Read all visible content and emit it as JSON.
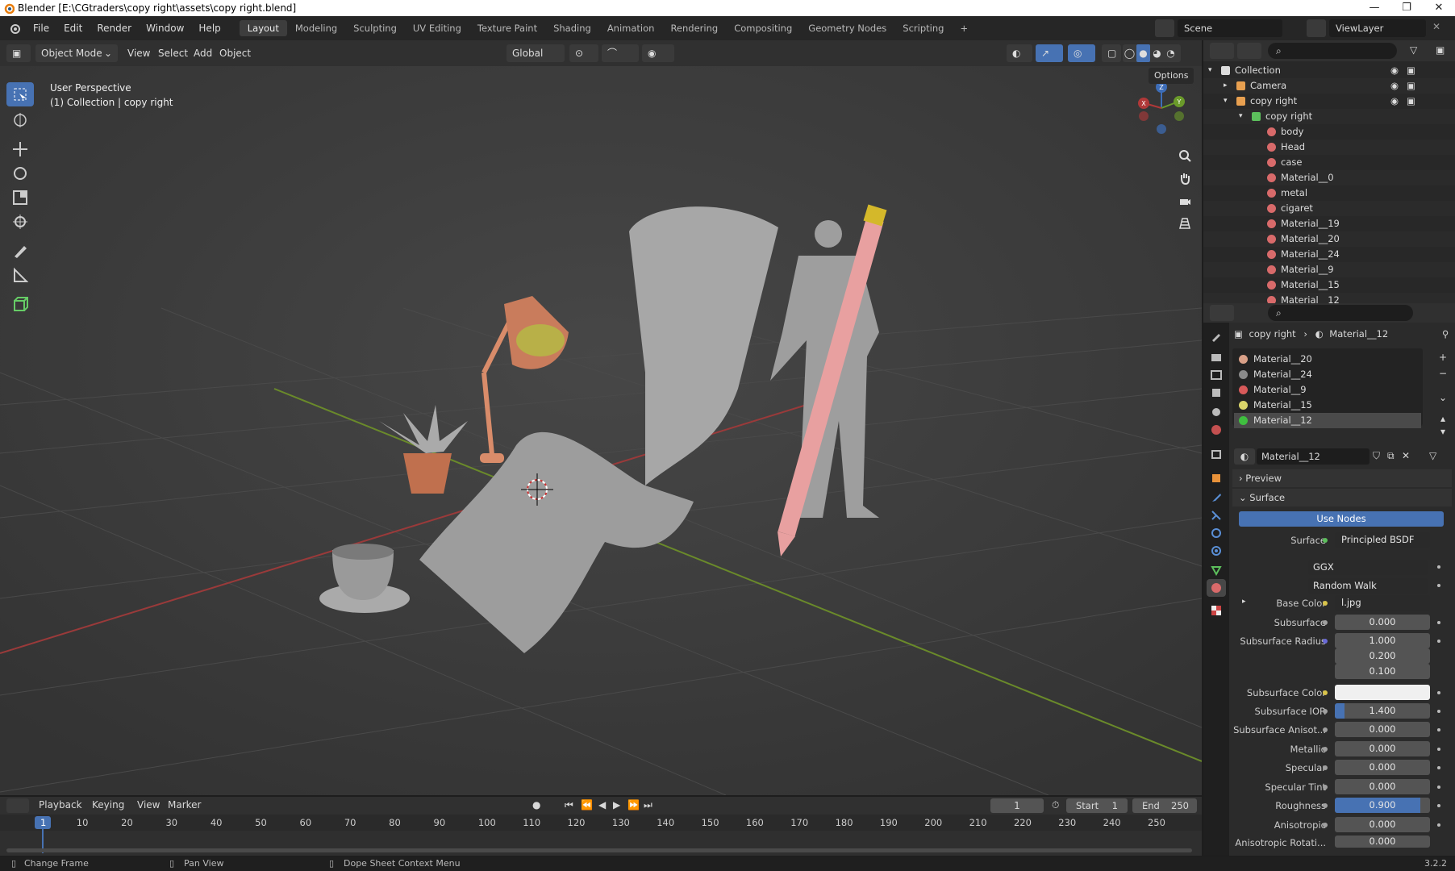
{
  "window": {
    "title": "Blender [E:\\CGtraders\\copy right\\assets\\copy right.blend]",
    "minimize": "—",
    "maximize": "❐",
    "close": "✕"
  },
  "menus": [
    "File",
    "Edit",
    "Render",
    "Window",
    "Help"
  ],
  "workspaces": [
    "Layout",
    "Modeling",
    "Sculpting",
    "UV Editing",
    "Texture Paint",
    "Shading",
    "Animation",
    "Rendering",
    "Compositing",
    "Geometry Nodes",
    "Scripting"
  ],
  "add_workspace": "+",
  "scene": {
    "name": "Scene",
    "view_layer": "ViewLayer"
  },
  "viewport_header": {
    "mode": "Object Mode",
    "menus": [
      "View",
      "Select",
      "Add",
      "Object"
    ],
    "orientation": "Global",
    "options": "Options"
  },
  "viewport": {
    "perspective": "User Perspective",
    "collection_label": "(1) Collection | copy right",
    "gizmo": {
      "z": "Z",
      "y": "Y",
      "x": "X"
    }
  },
  "outliner": {
    "items": [
      {
        "label": "Collection",
        "depth": 0,
        "icon": "collection-icon",
        "expanded": true
      },
      {
        "label": "Camera",
        "depth": 1,
        "icon": "camera-icon",
        "expanded": false
      },
      {
        "label": "copy right",
        "depth": 1,
        "icon": "mesh-object-icon",
        "expanded": true
      },
      {
        "label": "copy right",
        "depth": 2,
        "icon": "mesh-data-icon",
        "expanded": true
      },
      {
        "label": "body",
        "depth": 3,
        "icon": "material-icon"
      },
      {
        "label": "Head",
        "depth": 3,
        "icon": "material-icon"
      },
      {
        "label": "case",
        "depth": 3,
        "icon": "material-icon"
      },
      {
        "label": "Material__0",
        "depth": 3,
        "icon": "material-icon"
      },
      {
        "label": "metal",
        "depth": 3,
        "icon": "material-icon"
      },
      {
        "label": "cigaret",
        "depth": 3,
        "icon": "material-icon"
      },
      {
        "label": "Material__19",
        "depth": 3,
        "icon": "material-icon"
      },
      {
        "label": "Material__20",
        "depth": 3,
        "icon": "material-icon"
      },
      {
        "label": "Material__24",
        "depth": 3,
        "icon": "material-icon"
      },
      {
        "label": "Material__9",
        "depth": 3,
        "icon": "material-icon"
      },
      {
        "label": "Material__15",
        "depth": 3,
        "icon": "material-icon"
      },
      {
        "label": "Material__12",
        "depth": 3,
        "icon": "material-icon"
      }
    ]
  },
  "properties": {
    "breadcrumb": {
      "object": "copy right",
      "material": "Material__12"
    },
    "slots": [
      {
        "label": "Material__20",
        "color": "#d9a088"
      },
      {
        "label": "Material__24",
        "color": "#8a8a8a"
      },
      {
        "label": "Material__9",
        "color": "#d85a5a"
      },
      {
        "label": "Material__15",
        "color": "#d9d46a"
      },
      {
        "label": "Material__12",
        "color": "#3fbf3f",
        "selected": true
      }
    ],
    "material_name": "Material__12",
    "sections": {
      "preview": "Preview",
      "surface": "Surface"
    },
    "use_nodes": "Use Nodes",
    "fields": {
      "surface_label": "Surface",
      "surface_value": "Principled BSDF",
      "distribution": "GGX",
      "subsurface_method": "Random Walk",
      "base_color_label": "Base Color",
      "base_color_value": "l.jpg",
      "subsurface_label": "Subsurface",
      "subsurface_value": "0.000",
      "subsurface_radius_label": "Subsurface Radius",
      "radius_1": "1.000",
      "radius_2": "0.200",
      "radius_3": "0.100",
      "subsurface_color_label": "Subsurface Color",
      "subsurface_ior_label": "Subsurface IOR",
      "subsurface_ior_value": "1.400",
      "subsurface_aniso_label": "Subsurface Anisot...",
      "subsurface_aniso_value": "0.000",
      "metallic_label": "Metallic",
      "metallic_value": "0.000",
      "specular_label": "Specular",
      "specular_value": "0.000",
      "specular_tint_label": "Specular Tint",
      "specular_tint_value": "0.000",
      "roughness_label": "Roughness",
      "roughness_value": "0.900",
      "anisotropic_label": "Anisotropic",
      "anisotropic_value": "0.000",
      "aniso_rotation_label": "Anisotropic Rotati...",
      "aniso_rotation_value": "0.000"
    },
    "slider_levels": {
      "subsurface_ior": 0.1,
      "roughness": 0.9
    }
  },
  "timeline": {
    "menus": [
      "Playback",
      "Keying",
      "View",
      "Marker"
    ],
    "current_frame": "1",
    "start_label": "Start",
    "start": "1",
    "end_label": "End",
    "end": "250",
    "ruler": [
      "1",
      "10",
      "20",
      "30",
      "40",
      "50",
      "60",
      "70",
      "80",
      "90",
      "100",
      "110",
      "120",
      "130",
      "140",
      "150",
      "160",
      "170",
      "180",
      "190",
      "200",
      "210",
      "220",
      "230",
      "240",
      "250"
    ]
  },
  "statusbar": {
    "left": "Change Frame",
    "middle": "Pan View",
    "right": "Dope Sheet Context Menu",
    "version": "3.2.2"
  },
  "colors": {
    "accent": "#4772b3",
    "x_axis": "#b03838",
    "y_axis": "#6a9a2a",
    "lamp": "#d98c6a",
    "pencil": "#e8a0a0"
  }
}
